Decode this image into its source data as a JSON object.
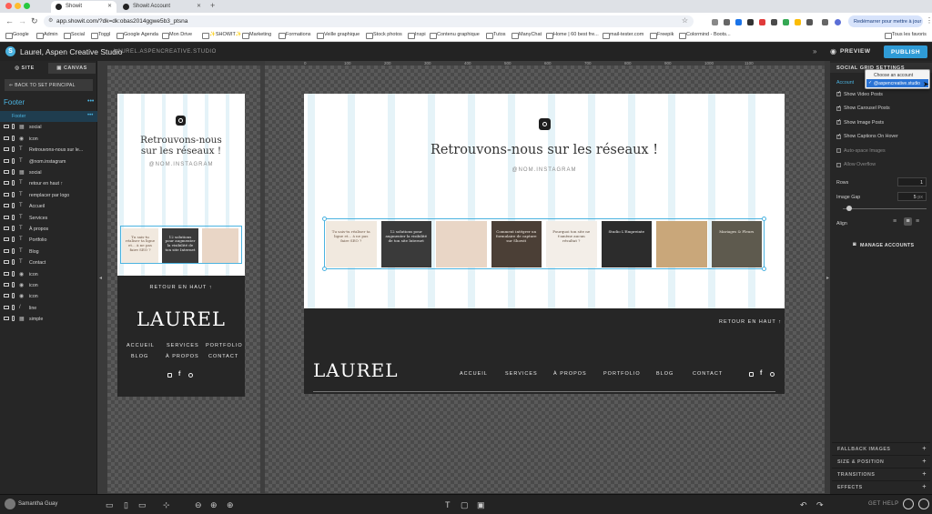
{
  "browser": {
    "tabs": [
      {
        "label": "Showit"
      },
      {
        "label": "Showit Account"
      }
    ],
    "new_tab": "+",
    "url": "app.showit.com/?dk=dk:obas2014ggwe5b3_ptsna",
    "relaunch_label": "Redémarrer pour mettre à jour",
    "bookmarks": [
      "Google",
      "Admin",
      "Social",
      "Toggl",
      "Google Agenda",
      "Mon Drive",
      "✨SHOWIT✨",
      "Marketing",
      "Formations",
      "Veille graphique",
      "Stock photos",
      "Inspi",
      "Contenu graphique",
      "Tutos",
      "ManyChat",
      "Home | 60 best fre...",
      "mail-tester.com",
      "Freepik",
      "Colormind - Boots..."
    ],
    "all_bookmarks": "Tous les favoris"
  },
  "app": {
    "title": "Laurel, Aspen Creative Studio",
    "subtitle": "LAUREL.ASPENCREATIVE.STUDIO",
    "preview_label": "PREVIEW",
    "publish_label": "PUBLISH",
    "brand_color": "#4bb3e0"
  },
  "left_panel": {
    "tabs": [
      "SITE",
      "CANVAS"
    ],
    "back_label": "BACK TO SET PRINCIPAL",
    "section_title": "Footer",
    "layers": [
      {
        "label": "Footer",
        "type": "",
        "selected": true
      },
      {
        "label": "social",
        "type": "▦"
      },
      {
        "label": "icon",
        "type": "◉"
      },
      {
        "label": "Retrouvons-nous sur le...",
        "type": "T"
      },
      {
        "label": "@nom.instagram",
        "type": "T"
      },
      {
        "label": "social",
        "type": "▦"
      },
      {
        "label": "retour en haut ↑",
        "type": "T"
      },
      {
        "label": "remplacer par logo",
        "type": "T"
      },
      {
        "label": "Accueil",
        "type": "T"
      },
      {
        "label": "Services",
        "type": "T"
      },
      {
        "label": "À propos",
        "type": "T"
      },
      {
        "label": "Portfolio",
        "type": "T"
      },
      {
        "label": "Blog",
        "type": "T"
      },
      {
        "label": "Contact",
        "type": "T"
      },
      {
        "label": "icon",
        "type": "◉"
      },
      {
        "label": "icon",
        "type": "◉"
      },
      {
        "label": "icon",
        "type": "◉"
      },
      {
        "label": "line",
        "type": "/"
      },
      {
        "label": "simple",
        "type": "▦"
      }
    ]
  },
  "canvas": {
    "ruler_ticks": [
      "0",
      "100",
      "200",
      "300",
      "400",
      "500",
      "600",
      "700",
      "800",
      "900",
      "1000",
      "1100"
    ],
    "heading_line1": "Retrouvons-nous",
    "heading_line2": "sur les réseaux !",
    "heading_full": "Retrouvons-nous sur les réseaux !",
    "handle": "@NOM.INSTAGRAM",
    "back_to_top": "RETOUR EN HAUT ↑",
    "logo_text": "LAUREL",
    "nav_mobile": [
      "ACCUEIL",
      "SERVICES",
      "PORTFOLIO",
      "BLOG",
      "À PROPOS",
      "CONTACT"
    ],
    "nav_desktop": [
      "ACCUEIL",
      "SERVICES",
      "À PROPOS",
      "PORTFOLIO",
      "BLOG",
      "CONTACT"
    ],
    "posts": [
      {
        "text": "Tu sais-tu réaliser ta ligne et... à ne pas faire SEO ?",
        "bg": "#f1e9df",
        "fg": "#6b5443"
      },
      {
        "text": "12 solutions pour augmenter la visibilité de ton site Internet",
        "bg": "#3a3a3a",
        "fg": "#f0f0f0"
      },
      {
        "text": "",
        "bg": "#e9d6c6",
        "fg": "#7a4c3a"
      },
      {
        "text": "Comment intégrer un formulaire de capture sur Showit",
        "bg": "#4b3f36",
        "fg": "#f5eee6"
      },
      {
        "text": "Pourquoi ton site ne t'amène aucun résultat ?",
        "bg": "#f3eee8",
        "fg": "#5a4a3c"
      },
      {
        "text": "Studio L'Empreinte",
        "bg": "#2c2c2c",
        "fg": "#f0f0f0"
      },
      {
        "text": "",
        "bg": "#c9a77a",
        "fg": "#3a2a1c"
      },
      {
        "text": "Mariages & Fleurs",
        "bg": "#5e5a4e",
        "fg": "#f4efe6"
      }
    ]
  },
  "right_panel": {
    "title": "SOCIAL GRID SETTINGS",
    "account_label": "Account",
    "dropdown_options": [
      "Choose an account",
      "@aspencreative.studio"
    ],
    "dropdown_selected": "@aspencreative.studio",
    "checkboxes": [
      {
        "label": "Show Video Posts",
        "checked": true
      },
      {
        "label": "Show Carousel Posts",
        "checked": true
      },
      {
        "label": "Show Image Posts",
        "checked": true
      },
      {
        "label": "Show Captions On Hover",
        "checked": true
      },
      {
        "label": "Auto-space Images",
        "checked": false
      },
      {
        "label": "Allow Overflow",
        "checked": false
      }
    ],
    "rows_label": "Rows",
    "rows_value": "1",
    "gap_label": "Image Gap",
    "gap_value": "5",
    "gap_unit": "px",
    "align_label": "Align",
    "manage_label": "MANAGE ACCOUNTS",
    "sections": [
      "FALLBACK IMAGES",
      "SIZE & POSITION",
      "TRANSITIONS",
      "EFFECTS"
    ]
  },
  "bottom_bar": {
    "user_name": "Samantha Guay",
    "help_label": "GET HELP"
  }
}
